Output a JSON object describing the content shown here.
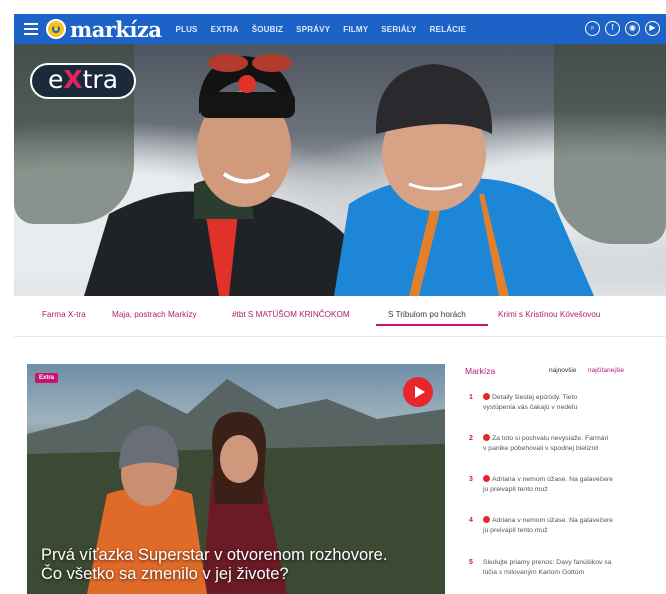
{
  "header": {
    "logo_text": "markíza",
    "nav": [
      "PLUS",
      "EXTRA",
      "ŠOUBIZ",
      "SPRÁVY",
      "FILMY",
      "SERIÁLY",
      "RELÁCIE"
    ],
    "colors": {
      "brand_blue": "#1d62c6",
      "accent_pink": "#c5156f"
    }
  },
  "hero": {
    "badge_prefix": "e",
    "badge_x": "X",
    "badge_suffix": "tra"
  },
  "tabs": [
    {
      "label": "Farma X-tra"
    },
    {
      "label": "Maja, postrach Markízy"
    },
    {
      "label": "#tbt S MATÚŠOM KRINČOKOM"
    },
    {
      "label": "S Tribulom po horách",
      "active": true
    },
    {
      "label": "Krimi s Kristínou Kövešovou"
    }
  ],
  "card": {
    "tag": "Extra",
    "title_line1": "Prvá víťazka Superstar v otvorenom rozhovore.",
    "title_line2": "Čo všetko sa zmenilo v jej živote?"
  },
  "sidebar": {
    "title": "Markíza",
    "filter1": "najnovšie",
    "filter2": "najčítanejšie",
    "items": [
      {
        "num": "1",
        "line1": "Detaily šiestej epizódy. Tieto",
        "line2": "vystúpenia vás čakajú v nedeľu",
        "hot": true
      },
      {
        "num": "2",
        "line1": "Za toto si pochvalu nevysiaže. Farmári",
        "line2": "v panike pobehovali v spodnej bielizni!",
        "hot": true
      },
      {
        "num": "3",
        "line1": "Adriana v nemom úžase. Na galavečere",
        "line2": "ju preivaplí tento muž",
        "hot": true
      },
      {
        "num": "4",
        "line1": "Adriana v nemom úžase. Na galavečere",
        "line2": "ju preivaplí tento muž",
        "hot": true
      },
      {
        "num": "5",
        "line1": "Sledujte priamy prenos: Davy fanúšikov sa",
        "line2": "lúčia s milovaným Karlom Gottom",
        "hot": false
      }
    ]
  }
}
